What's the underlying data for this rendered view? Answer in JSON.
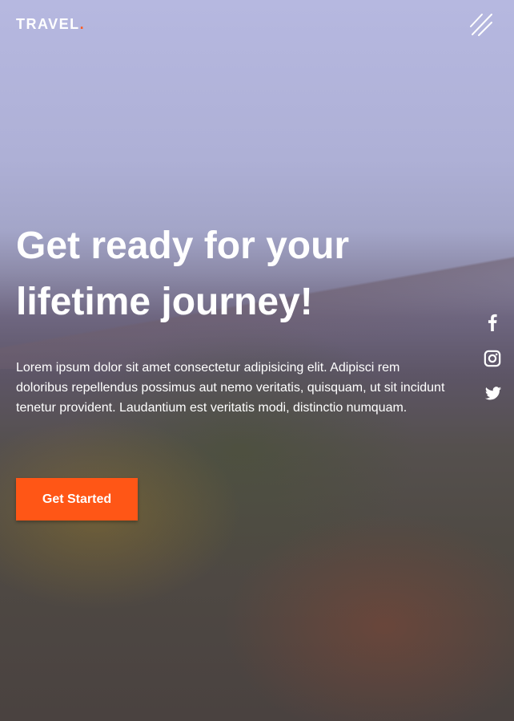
{
  "header": {
    "logo_text": "TRAVEL",
    "logo_dot": ".",
    "menu_icon": "menu-lines-icon"
  },
  "hero": {
    "title": "Get ready for your lifetime journey!",
    "description": "Lorem ipsum dolor sit amet consectetur adipisicing elit. Adipisci rem doloribus repellendus possimus aut nemo veritatis, quisquam, ut sit incidunt tenetur provident. Laudantium est veritatis modi, distinctio numquam.",
    "cta_label": "Get Started"
  },
  "social": [
    "facebook-icon",
    "instagram-icon",
    "twitter-icon"
  ],
  "colors": {
    "accent": "#ff5616"
  }
}
